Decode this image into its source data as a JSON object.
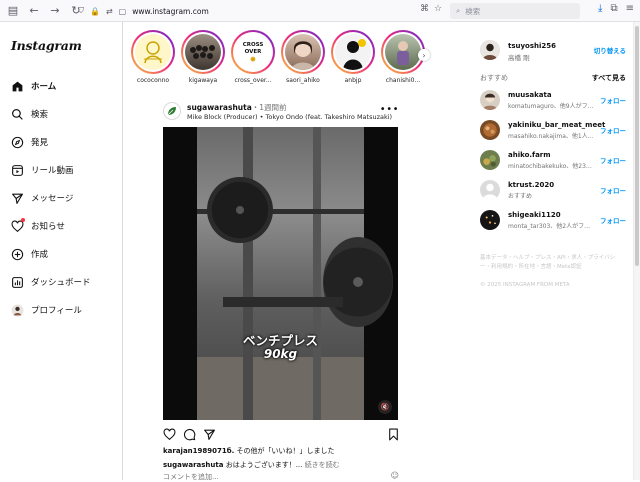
{
  "browser": {
    "url": "www.instagram.com",
    "search_placeholder": "検索"
  },
  "nav": {
    "logo": "Instagram",
    "items": [
      {
        "label": "ホーム",
        "icon": "home-icon"
      },
      {
        "label": "検索",
        "icon": "search-icon"
      },
      {
        "label": "発見",
        "icon": "compass-icon"
      },
      {
        "label": "リール動画",
        "icon": "reels-icon"
      },
      {
        "label": "メッセージ",
        "icon": "send-icon"
      },
      {
        "label": "お知らせ",
        "icon": "heart-icon"
      },
      {
        "label": "作成",
        "icon": "plus-square-icon"
      },
      {
        "label": "ダッシュボード",
        "icon": "dashboard-icon"
      },
      {
        "label": "プロフィール",
        "icon": "profile-avatar"
      }
    ]
  },
  "stories": [
    {
      "name": "cococonno"
    },
    {
      "name": "kigawaya"
    },
    {
      "name": "cross_over..."
    },
    {
      "name": "saori_ahiko"
    },
    {
      "name": "anbjp"
    },
    {
      "name": "chanishi0..."
    }
  ],
  "story_badge_text": "CROSS OVER",
  "post": {
    "username": "sugawarashuta",
    "time": "・1週間前",
    "audio": "Mike Block (Producer) • Tokyo Ondo (feat. Takeshiro Matsuzaki)",
    "caption_line1": "ベンチプレス",
    "caption_line2": "90kg",
    "likes_user": "karajan1989071б.",
    "likes_text": "その他が「いいね！」しました",
    "caption_user": "sugawarashuta",
    "caption_text": "おはようございます！...",
    "caption_more": "続きを読む",
    "comment_placeholder": "コメントを追加..."
  },
  "me": {
    "username": "tsuyoshi256",
    "name": "高橋 剛",
    "switch_label": "切り替える"
  },
  "recommend": {
    "title": "おすすめ",
    "see_all": "すべて見る",
    "follow_label": "フォロー",
    "items": [
      {
        "username": "muusakata",
        "sub": "komatumaguro、他9人がフォロー中"
      },
      {
        "username": "yakiniku_bar_meat_meet",
        "sub": "masahiko.nakajima、他1人がフォロー中"
      },
      {
        "username": "ahiko.farm",
        "sub": "minatochibakekuko、他23人がフォロー中"
      },
      {
        "username": "ktrust.2020",
        "sub": "おすすめ"
      },
      {
        "username": "shigeaki1120",
        "sub": "monta_tar303、他2人がフォロー中"
      }
    ]
  },
  "footer": {
    "links": "基本データ・ヘルプ・プレス・API・求人・プライバシー・利用規約・所在地・言語・Meta認証",
    "copyright": "© 2025 INSTAGRAM FROM META"
  }
}
